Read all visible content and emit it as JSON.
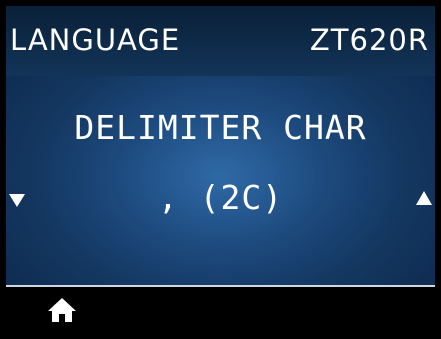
{
  "header": {
    "menu_title": "LANGUAGE",
    "model": "ZT620R"
  },
  "setting": {
    "name": "DELIMITER CHAR",
    "value": ", (2C)"
  },
  "controls": {
    "previous_icon": "down-triangle-icon",
    "next_icon": "up-triangle-icon",
    "home_icon": "home-icon"
  },
  "colors": {
    "background_center": "#2f6aa6",
    "background_edge": "#0f2d52",
    "text": "#ffffff",
    "bottom_bar": "#000000"
  }
}
